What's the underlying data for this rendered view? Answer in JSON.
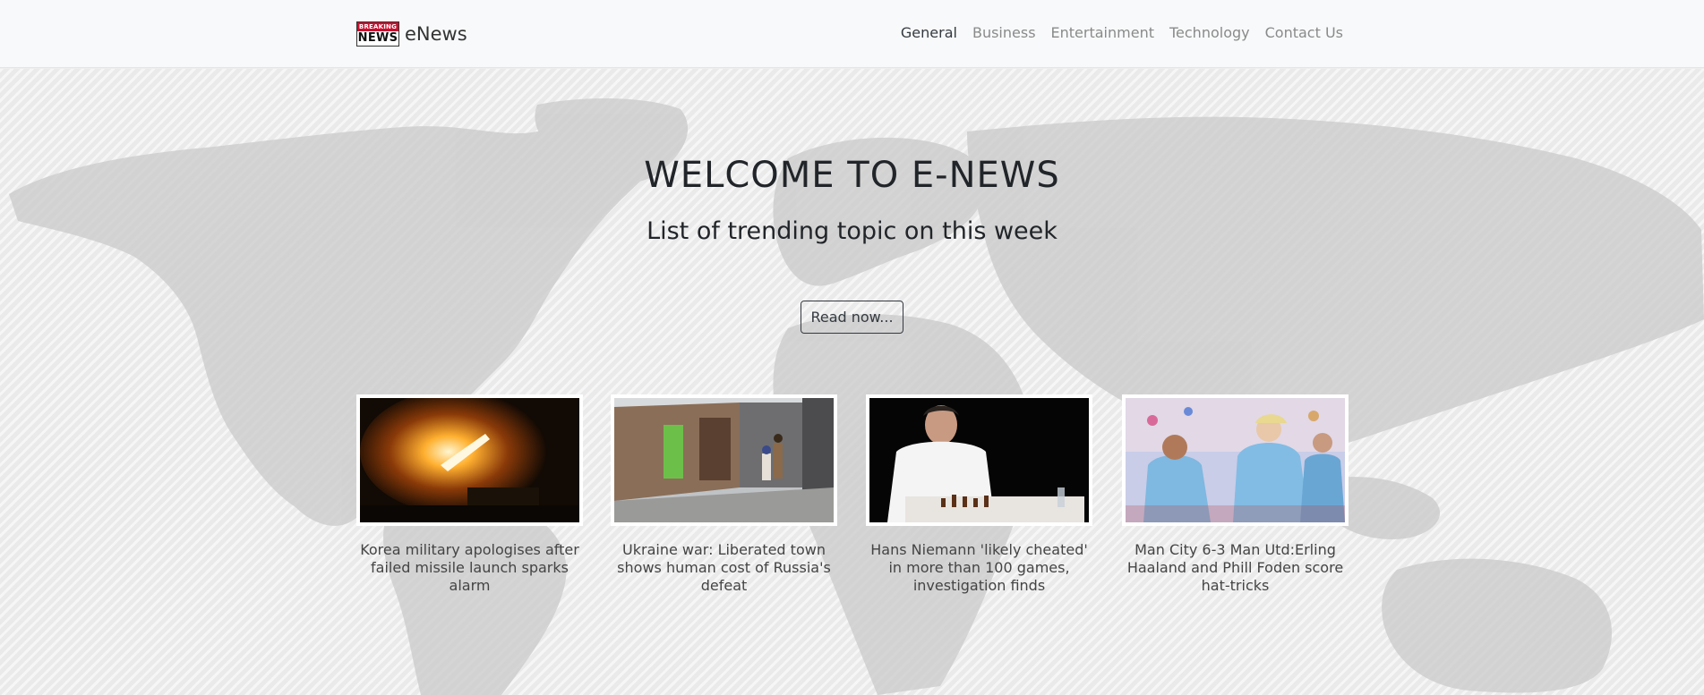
{
  "navbar": {
    "logo_top": "BREAKING",
    "logo_bottom": "NEWS",
    "brand": "eNews",
    "links": [
      "General",
      "Business",
      "Entertainment",
      "Technology",
      "Contact Us"
    ]
  },
  "hero": {
    "title": "WELCOME TO E-NEWS",
    "subtitle": "List of trending topic on this week",
    "button": "Read now..."
  },
  "articles": [
    {
      "title": "Korea military apologises after failed missile launch sparks alarm"
    },
    {
      "title": "Ukraine war: Liberated town shows human cost of Russia's defeat"
    },
    {
      "title": "Hans Niemann 'likely cheated' in more than 100 games, investigation finds"
    },
    {
      "title": "Man City 6-3 Man Utd:Erling Haaland and Phill Foden score hat-tricks"
    }
  ]
}
